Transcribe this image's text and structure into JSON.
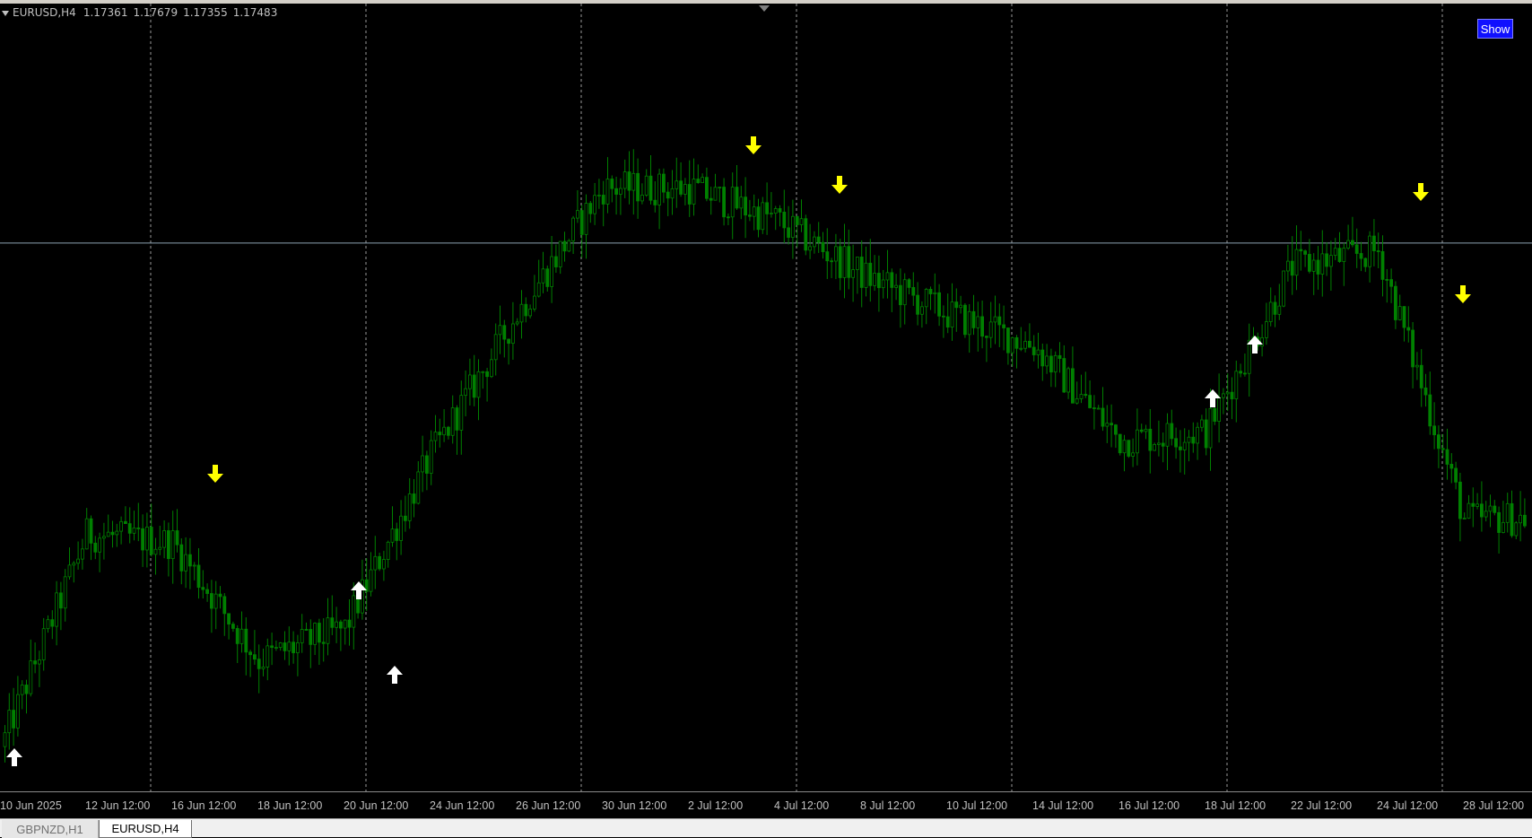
{
  "chart_header": {
    "symbol": "EURUSD,H4",
    "open": "1.17361",
    "high": "1.17679",
    "low": "1.17355",
    "close": "1.17483"
  },
  "show_button": {
    "label": "Show"
  },
  "colors": {
    "background": "#000000",
    "candle": "#008000",
    "grid": "#9a9a9a",
    "price_line": "#8aa0b0",
    "sell_arrow": "#ffff00",
    "buy_arrow": "#ffffff",
    "show_button": "#1010ff"
  },
  "time_axis": {
    "labels": [
      "10 Jun 2025",
      "12 Jun 12:00",
      "16 Jun 12:00",
      "18 Jun 12:00",
      "20 Jun 12:00",
      "24 Jun 12:00",
      "26 Jun 12:00",
      "30 Jun 12:00",
      "2 Jul 12:00",
      "4 Jul 12:00",
      "8 Jul 12:00",
      "10 Jul 12:00",
      "14 Jul 12:00",
      "16 Jul 12:00",
      "18 Jul 12:00",
      "22 Jul 12:00",
      "24 Jul 12:00",
      "28 Jul 12:00"
    ]
  },
  "tabs": [
    {
      "label": "GBPNZD,H1",
      "active": false
    },
    {
      "label": "EURUSD,H4",
      "active": true
    }
  ],
  "chart_data": {
    "type": "candlestick",
    "symbol": "EURUSD",
    "timeframe": "H4",
    "price_line": 1.1745,
    "approx_close_path": [
      [
        "10 Jun 2025",
        1.1425
      ],
      [
        "12 Jun 12:00",
        1.156
      ],
      [
        "16 Jun 12:00",
        1.1555
      ],
      [
        "18 Jun 12:00",
        1.148
      ],
      [
        "20 Jun 12:00",
        1.15
      ],
      [
        "24 Jun 12:00",
        1.161
      ],
      [
        "26 Jun 12:00",
        1.17
      ],
      [
        "30 Jun 12:00",
        1.178
      ],
      [
        "2 Jul 12:00",
        1.178
      ],
      [
        "4 Jul 12:00",
        1.176
      ],
      [
        "8 Jul 12:00",
        1.1725
      ],
      [
        "10 Jul 12:00",
        1.17
      ],
      [
        "14 Jul 12:00",
        1.168
      ],
      [
        "16 Jul 12:00",
        1.162
      ],
      [
        "18 Jul 12:00",
        1.1625
      ],
      [
        "22 Jul 12:00",
        1.173
      ],
      [
        "24 Jul 12:00",
        1.174
      ],
      [
        "28 Jul 12:00",
        1.157
      ]
    ],
    "signals": [
      {
        "type": "buy",
        "time": "10 Jun 2025"
      },
      {
        "type": "sell",
        "time": "16 Jun 12:00"
      },
      {
        "type": "buy",
        "time": "20 Jun 12:00"
      },
      {
        "type": "buy",
        "time": "20 Jun 12:00"
      },
      {
        "type": "sell",
        "time": "2 Jul 12:00"
      },
      {
        "type": "sell",
        "time": "4 Jul 12:00"
      },
      {
        "type": "buy",
        "time": "18 Jul 12:00"
      },
      {
        "type": "buy",
        "time": "18 Jul 12:00"
      },
      {
        "type": "sell",
        "time": "24 Jul 12:00"
      },
      {
        "type": "sell",
        "time": "28 Jul 12:00"
      }
    ],
    "grid": "vertical dotted"
  }
}
